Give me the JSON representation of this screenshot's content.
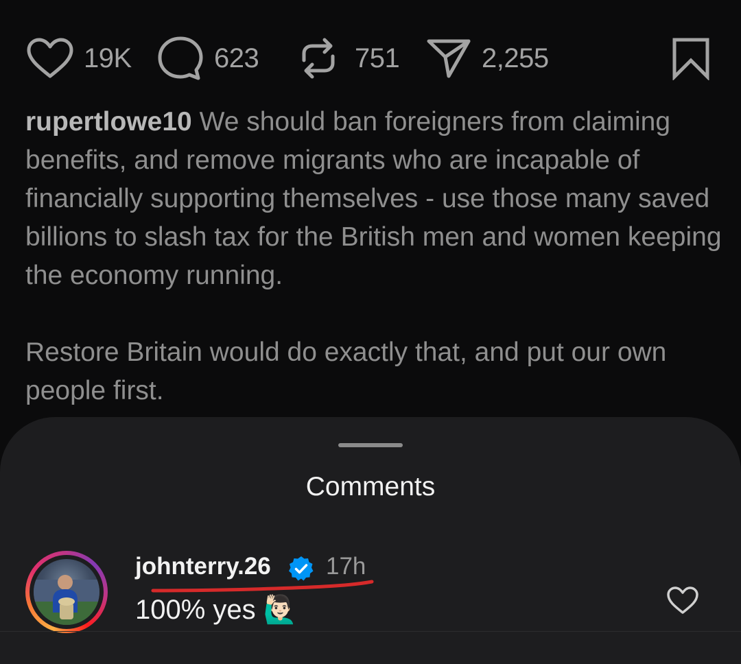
{
  "post": {
    "stats": {
      "likes": "19K",
      "comments": "623",
      "reposts": "751",
      "shares": "2,255"
    },
    "icons": [
      "heart-icon",
      "comment-bubble-icon",
      "repost-icon",
      "send-icon",
      "bookmark-icon"
    ],
    "caption": {
      "username": "rupertlowe10",
      "text": " We should ban foreigners from claiming benefits, and remove migrants who are incapable of financially supporting themselves - use those many saved billions to slash tax for the British men and women keeping the economy running.\n\nRestore Britain would do exactly that, and put our own people first."
    }
  },
  "comments_sheet": {
    "title": "Comments",
    "comments": [
      {
        "username": "johnterry.26",
        "verified": true,
        "time": "17h",
        "text": "100% yes 🙋🏻‍♂️"
      }
    ]
  },
  "colors": {
    "background": "#0b0b0c",
    "sheet": "#1d1d1f",
    "verified": "#0095f6",
    "annotation": "#d62a2a"
  }
}
